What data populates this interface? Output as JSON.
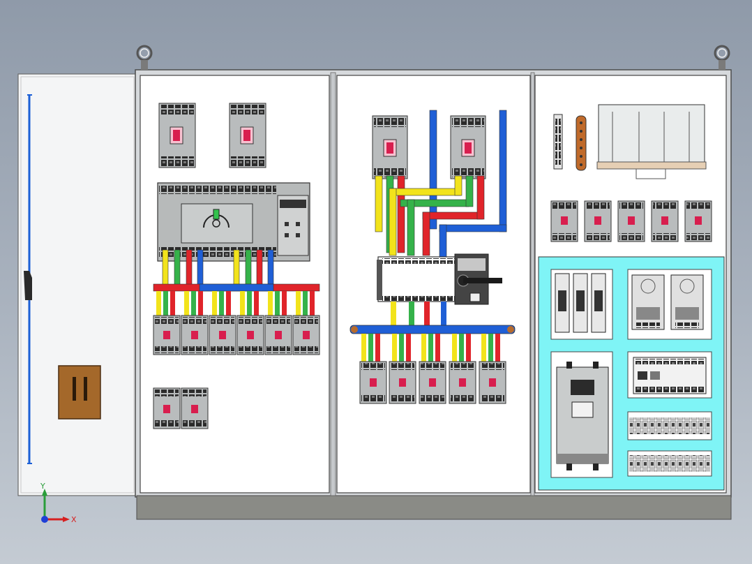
{
  "axis_triad": {
    "y_label": "Y",
    "x_label": "X"
  },
  "colors": {
    "background_top": "#8f9aa9",
    "background_bottom": "#c4cbd3",
    "panel": "#ffffff",
    "cabinet_frame": "#d6d9dc",
    "base": "#8a8b86",
    "phase_yellow": "#f2e31b",
    "phase_green": "#35b24a",
    "phase_red": "#e0242a",
    "neutral_blue": "#1f5fd6",
    "mounting_rail_cyan": "#7ff4f6",
    "breaker_gray": "#b9bcbd",
    "breaker_handle": "#d81e4e",
    "copper_bar": "#c06a2a",
    "door_handle": "#a4682a"
  },
  "icons": {
    "lifting_eyes": "ring-bolt-icon",
    "axis_triad": "xyz-axis-icon",
    "door_handle": "door-lock-icon"
  }
}
